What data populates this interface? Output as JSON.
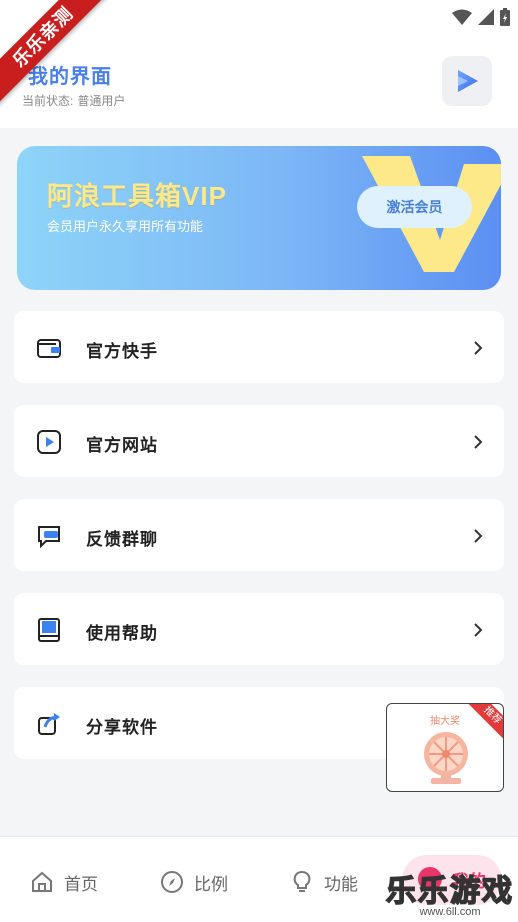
{
  "status": {
    "icons": [
      "wifi-icon",
      "signal-icon",
      "battery-charging-icon"
    ]
  },
  "watermark_ribbon": "乐乐亲测",
  "header": {
    "title": "我的界面",
    "status_label": "当前状态:",
    "status_value": "普通用户"
  },
  "vip": {
    "title": "阿浪工具箱VIP",
    "subtitle": "会员用户永久享用所有功能",
    "button": "激活会员",
    "letter": "V"
  },
  "menu": [
    {
      "label": "官方快手",
      "icon": "wallet-icon"
    },
    {
      "label": "官方网站",
      "icon": "play-circle-icon"
    },
    {
      "label": "反馈群聊",
      "icon": "chat-icon"
    },
    {
      "label": "使用帮助",
      "icon": "book-icon"
    },
    {
      "label": "分享软件",
      "icon": "share-icon"
    }
  ],
  "promo": {
    "title": "抽大奖",
    "badge": "推荐"
  },
  "tabs": [
    {
      "label": "首页",
      "icon": "home-icon"
    },
    {
      "label": "比例",
      "icon": "compass-icon"
    },
    {
      "label": "功能",
      "icon": "bulb-icon"
    },
    {
      "label": "我的",
      "icon": "user-icon",
      "active": true
    }
  ],
  "site_watermark": {
    "big": "乐乐游戏",
    "small": "www.6ll.com"
  },
  "colors": {
    "accent": "#4a7fe8",
    "active_tab": "#e8366a",
    "vip_gold": "#fde98a"
  }
}
